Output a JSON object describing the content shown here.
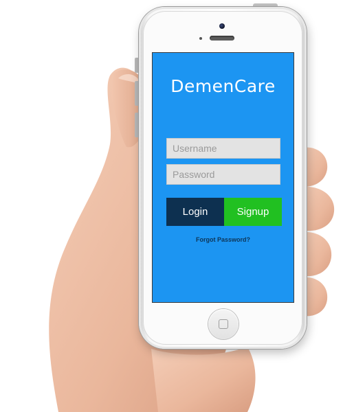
{
  "app": {
    "title": "DemenCare"
  },
  "login_form": {
    "username_placeholder": "Username",
    "password_placeholder": "Password",
    "login_label": "Login",
    "signup_label": "Signup",
    "forgot_password_label": "Forgot Password?"
  },
  "colors": {
    "screen_background": "#1c95f2",
    "login_button": "#0d3050",
    "signup_button": "#21c021",
    "forgot_link": "#0e3557",
    "input_background": "#e3e3e3"
  },
  "icons": {
    "device": "smartphone-icon",
    "home_button": "home-button-icon",
    "camera": "front-camera-icon",
    "speaker": "earpiece-speaker-icon"
  }
}
